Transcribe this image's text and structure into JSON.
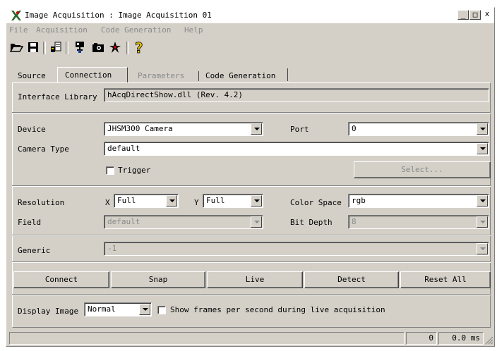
{
  "window": {
    "title": "Image Acquisition : Image Acquisition 01",
    "minimize": "_",
    "maximize": "□",
    "close": "x"
  },
  "menu": [
    "File",
    "Acquisition",
    "Code Generation",
    "Help"
  ],
  "toolbar": {
    "icons": [
      "open-folder-icon",
      "save-icon",
      "acquisition-params-icon",
      "connect-camera-icon",
      "snap-camera-icon",
      "live-icon",
      "help-icon"
    ],
    "help_glyph": "?"
  },
  "tabs": [
    {
      "label": "Source",
      "active": false,
      "enabled": true
    },
    {
      "label": "Connection",
      "active": true,
      "enabled": true
    },
    {
      "label": "Parameters",
      "active": false,
      "enabled": false
    },
    {
      "label": "Code Generation",
      "active": false,
      "enabled": true
    }
  ],
  "connection": {
    "interface_library_label": "Interface Library",
    "interface_library_value": "hAcqDirectShow.dll (Rev. 4.2)",
    "device_label": "Device",
    "device_value": "JHSM300 Camera",
    "port_label": "Port",
    "port_value": "0",
    "camera_type_label": "Camera Type",
    "camera_type_value": "default",
    "trigger_label": "Trigger",
    "trigger_checked": false,
    "select_button": "Select...",
    "resolution_label": "Resolution",
    "x_label": "X",
    "x_value": "Full",
    "y_label": "Y",
    "y_value": "Full",
    "color_space_label": "Color Space",
    "color_space_value": "rgb",
    "field_label": "Field",
    "field_value": "default",
    "bit_depth_label": "Bit Depth",
    "bit_depth_value": "8",
    "generic_label": "Generic",
    "generic_value": "-1"
  },
  "actions": {
    "connect": "Connect",
    "snap": "Snap",
    "live": "Live",
    "detect": "Detect",
    "reset_all": "Reset All"
  },
  "display": {
    "label": "Display Image",
    "value": "Normal",
    "fps_label": "Show frames per second during live acquisition",
    "fps_checked": false
  },
  "status": {
    "message": "",
    "count": "0",
    "time": "0.0 ms"
  },
  "colors": {
    "face": "#d4d0c8",
    "disabled_text": "#8a8a8a",
    "icon_red": "#c00000",
    "icon_yellow": "#e8c000",
    "icon_blue": "#1c3c8c"
  }
}
